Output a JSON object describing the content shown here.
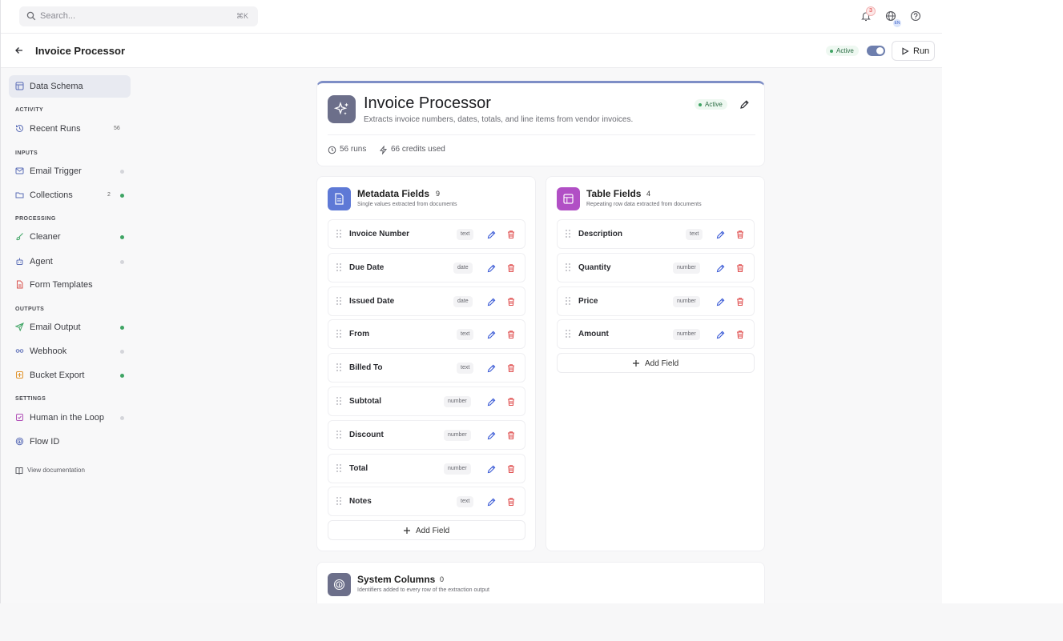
{
  "topbar": {
    "search_placeholder": "Search...",
    "shortcut": "⌘K",
    "notification_count": "3",
    "globe_badge": "EN"
  },
  "header": {
    "title": "Invoice Processor",
    "status": "Active",
    "run_label": "Run"
  },
  "sidebar": {
    "top": {
      "label": "Data Schema"
    },
    "sections": {
      "activity": "ACTIVITY",
      "inputs": "INPUTS",
      "processing": "PROCESSING",
      "outputs": "OUTPUTS",
      "settings": "SETTINGS"
    },
    "items": [
      {
        "label": "Recent Runs",
        "count": "56"
      },
      {
        "label": "Email Trigger"
      },
      {
        "label": "Collections",
        "count": "2"
      },
      {
        "label": "Cleaner"
      },
      {
        "label": "Agent"
      },
      {
        "label": "Form Templates"
      },
      {
        "label": "Email Output"
      },
      {
        "label": "Webhook"
      },
      {
        "label": "Bucket Export"
      },
      {
        "label": "Human in the Loop"
      },
      {
        "label": "Flow ID"
      }
    ],
    "doc_link": "View documentation"
  },
  "processor": {
    "title": "Invoice Processor",
    "description": "Extracts invoice numbers, dates, totals, and line items from vendor invoices.",
    "status": "Active",
    "runs": "56 runs",
    "credits": "66 credits used"
  },
  "metadata": {
    "title": "Metadata Fields",
    "count": "9",
    "subtitle": "Single values extracted from documents",
    "fields": [
      {
        "name": "Invoice Number",
        "type": "text"
      },
      {
        "name": "Due Date",
        "type": "date"
      },
      {
        "name": "Issued Date",
        "type": "date"
      },
      {
        "name": "From",
        "type": "text"
      },
      {
        "name": "Billed To",
        "type": "text"
      },
      {
        "name": "Subtotal",
        "type": "number"
      },
      {
        "name": "Discount",
        "type": "number"
      },
      {
        "name": "Total",
        "type": "number"
      },
      {
        "name": "Notes",
        "type": "text"
      }
    ],
    "add_label": "Add Field"
  },
  "table": {
    "title": "Table Fields",
    "count": "4",
    "subtitle": "Repeating row data extracted from documents",
    "fields": [
      {
        "name": "Description",
        "type": "text"
      },
      {
        "name": "Quantity",
        "type": "number"
      },
      {
        "name": "Price",
        "type": "number"
      },
      {
        "name": "Amount",
        "type": "number"
      }
    ],
    "add_label": "Add Field"
  },
  "system": {
    "title": "System Columns",
    "count": "0",
    "subtitle": "Identifiers added to every row of the extraction output"
  },
  "colors": {
    "accent": "#6e7fae",
    "active": "#3fa464",
    "delete": "#e05252",
    "edit": "#3b5bd6"
  }
}
